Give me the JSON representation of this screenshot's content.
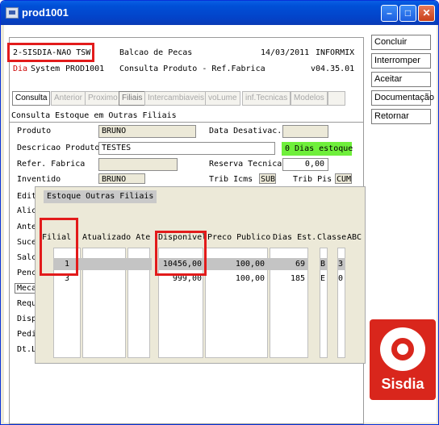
{
  "window": {
    "title": "prod1001"
  },
  "header": {
    "company": "2-SISDIA-NAO TSW",
    "center": "Balcao de Pecas",
    "date": "14/03/2011",
    "informix": "INFORMIX",
    "dia_label": "Dia",
    "system": "System",
    "program": "PROD1001",
    "subtitle": "Consulta Produto - Ref.Fabrica",
    "version": "v04.35.01"
  },
  "tabs": [
    "Consulta",
    "Anterior",
    "Proximo",
    "Filiais",
    "Intercambiaveis",
    "voLume",
    "inf.Tecnicas",
    "Modelos",
    ""
  ],
  "section_title": "Consulta Estoque em Outras Filiais",
  "form": {
    "produto_label": "Produto",
    "produto_value": "BRUNO",
    "data_desativac_label": "Data Desativac.",
    "descricao_label": "Descricao Produto",
    "descricao_value": "TESTES",
    "dias_estoque_badge": "0 Dias estoque",
    "refer_label": "Refer. Fabrica",
    "reserva_label": "Reserva Tecnica",
    "reserva_value": "0,00",
    "inventido_label": "Inventido",
    "inventido_value": "BRUNO",
    "trib_icms_label": "Trib Icms",
    "trib_icms_value": "SUB",
    "trib_pis_label": "Trib Pis",
    "trib_pis_value": "CUM"
  },
  "left_labels": [
    "Edit",
    "Alic",
    "Ante",
    "Suce",
    "Salc",
    "Penc",
    "Meca",
    "Requ",
    "Disp",
    "Pedi",
    "Dt.L"
  ],
  "popup": {
    "title": "Estoque Outras Filiais",
    "headers": {
      "filial": "Filial",
      "atualizado": "Atualizado Ate",
      "disponivel": "Disponivel",
      "preco": "Preco Publico",
      "dias": "Dias Est.",
      "classe": "Classe",
      "abc": "ABC"
    },
    "rows": [
      {
        "filial": "1",
        "atualizado": "",
        "disponivel": "10456,00",
        "preco": "100,00",
        "dias": "69",
        "classe": "B",
        "abc": "3"
      },
      {
        "filial": "3",
        "atualizado": "",
        "disponivel": "999,00",
        "preco": "100,00",
        "dias": "185",
        "classe": "E",
        "abc": "0"
      }
    ]
  },
  "side_buttons": [
    "Concluir",
    "Interromper",
    "Aceitar",
    "Documentação",
    "Retornar"
  ],
  "logo": {
    "text": "Sisdia"
  },
  "colors": {
    "highlight_red": "#e21b1b",
    "badge_green": "#6fef3b",
    "titlebar_blue": "#0343c9",
    "logo_red": "#d9261c"
  }
}
